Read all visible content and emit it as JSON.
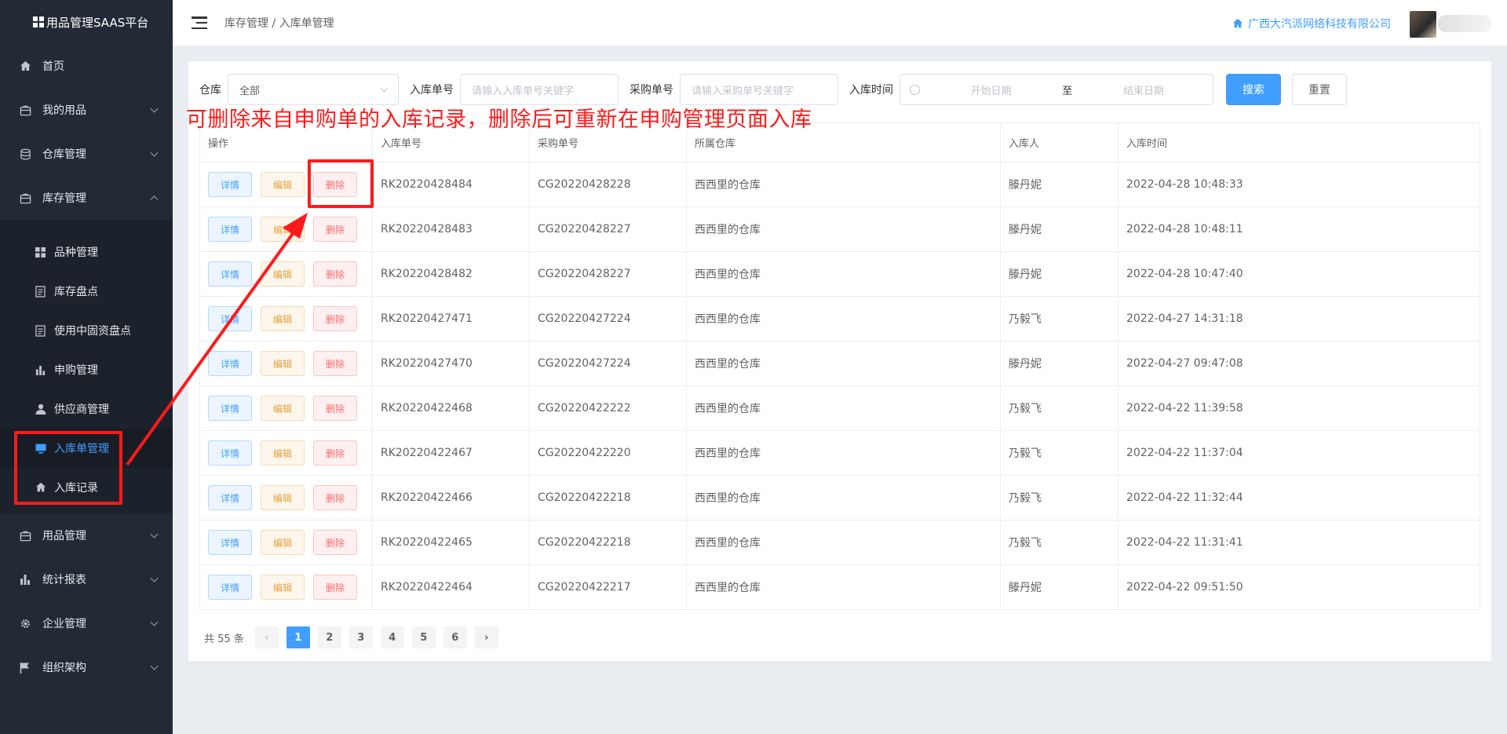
{
  "brand": {
    "title": "用品管理SAAS平台"
  },
  "sidebar": {
    "items": [
      {
        "label": "首页",
        "icon": "home-icon"
      },
      {
        "label": "我的用品",
        "icon": "bag-icon"
      },
      {
        "label": "仓库管理",
        "icon": "database-icon"
      },
      {
        "label": "库存管理",
        "icon": "briefcase-icon"
      },
      {
        "label": "用品管理",
        "icon": "bag-icon"
      },
      {
        "label": "统计报表",
        "icon": "bar-chart-icon"
      },
      {
        "label": "企业管理",
        "icon": "gear-icon"
      },
      {
        "label": "组织架构",
        "icon": "flag-icon"
      }
    ],
    "sub_items": [
      {
        "label": "品种管理",
        "icon": "grid-icon"
      },
      {
        "label": "库存盘点",
        "icon": "document-icon"
      },
      {
        "label": "使用中固资盘点",
        "icon": "document-icon"
      },
      {
        "label": "申购管理",
        "icon": "bar-chart-icon"
      },
      {
        "label": "供应商管理",
        "icon": "user-icon"
      },
      {
        "label": "入库单管理",
        "icon": "monitor-icon"
      },
      {
        "label": "入库记录",
        "icon": "home-icon"
      }
    ]
  },
  "header": {
    "breadcrumb": "库存管理 / 入库单管理",
    "company": "广西大汽派网络科技有限公司"
  },
  "filters": {
    "warehouse_label": "仓库",
    "warehouse_value": "全部",
    "inbound_no_label": "入库单号",
    "inbound_no_placeholder": "请输入入库单号关键字",
    "purchase_no_label": "采购单号",
    "purchase_no_placeholder": "请输入采购单号关键字",
    "time_label": "入库时间",
    "start_placeholder": "开始日期",
    "range_sep": "至",
    "end_placeholder": "结束日期",
    "search_label": "搜索",
    "reset_label": "重置"
  },
  "annotation": "可删除来自申购单的入库记录，删除后可重新在申购管理页面入库",
  "table": {
    "headers": [
      "操作",
      "入库单号",
      "采购单号",
      "所属仓库",
      "入库人",
      "入库时间"
    ],
    "op_labels": {
      "detail": "详情",
      "edit": "编辑",
      "delete": "删除"
    },
    "rows": [
      [
        "RK20220428484",
        "CG20220428228",
        "西西里的仓库",
        "滕丹妮",
        "2022-04-28 10:48:33"
      ],
      [
        "RK20220428483",
        "CG20220428227",
        "西西里的仓库",
        "滕丹妮",
        "2022-04-28 10:48:11"
      ],
      [
        "RK20220428482",
        "CG20220428227",
        "西西里的仓库",
        "滕丹妮",
        "2022-04-28 10:47:40"
      ],
      [
        "RK20220427471",
        "CG20220427224",
        "西西里的仓库",
        "乃毅飞",
        "2022-04-27 14:31:18"
      ],
      [
        "RK20220427470",
        "CG20220427224",
        "西西里的仓库",
        "滕丹妮",
        "2022-04-27 09:47:08"
      ],
      [
        "RK20220422468",
        "CG20220422222",
        "西西里的仓库",
        "乃毅飞",
        "2022-04-22 11:39:58"
      ],
      [
        "RK20220422467",
        "CG20220422220",
        "西西里的仓库",
        "乃毅飞",
        "2022-04-22 11:37:04"
      ],
      [
        "RK20220422466",
        "CG20220422218",
        "西西里的仓库",
        "乃毅飞",
        "2022-04-22 11:32:44"
      ],
      [
        "RK20220422465",
        "CG20220422218",
        "西西里的仓库",
        "乃毅飞",
        "2022-04-22 11:31:41"
      ],
      [
        "RK20220422464",
        "CG20220422217",
        "西西里的仓库",
        "滕丹妮",
        "2022-04-22 09:51:50"
      ]
    ]
  },
  "pagination": {
    "total_text": "共 55 条",
    "pages": [
      "1",
      "2",
      "3",
      "4",
      "5",
      "6"
    ],
    "current": "1",
    "prev": "‹",
    "next": "›"
  },
  "colors": {
    "accent": "#409eff",
    "annotation": "#ff1a1a",
    "sidebar": "#222a36"
  }
}
